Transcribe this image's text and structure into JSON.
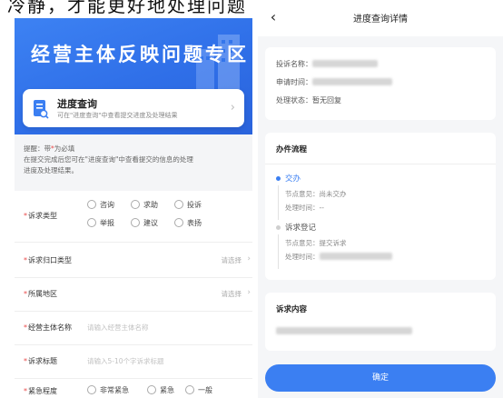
{
  "top_caption": "冷静，才能更好地处理问题",
  "left": {
    "banner_title": "经营主体反映问题专区",
    "query_card": {
      "title": "进度查询",
      "desc": "可在\"进度查询\"中查看提交进度及处理结果"
    },
    "notice": {
      "line1_prefix": "提醒：带",
      "required_mark": "*",
      "line1_suffix": "为必填",
      "line2": "在提交完成后您可在\"进度查询\"中查看提交的信息的处理",
      "line3": "进度及处理结果。"
    },
    "form": {
      "appeal_type": {
        "label": "诉求类型",
        "options": [
          "咨询",
          "求助",
          "投诉",
          "举报",
          "建议",
          "表扬"
        ]
      },
      "category": {
        "label": "诉求归口类型",
        "value": "请选择"
      },
      "region": {
        "label": "所属地区",
        "value": "请选择"
      },
      "entity_name": {
        "label": "经营主体名称",
        "placeholder": "请输入经营主体名称"
      },
      "appeal_title": {
        "label": "诉求标题",
        "placeholder": "请输入5-10个字诉求标题"
      },
      "urgency": {
        "label": "紧急程度",
        "options": [
          "非常紧急",
          "紧急",
          "一般"
        ]
      }
    }
  },
  "right": {
    "nav_title": "进度查询详情",
    "back_icon": "chevron-left-icon",
    "info": {
      "complaint_name_label": "投诉名称：",
      "apply_time_label": "申请时间：",
      "status_label": "处理状态：",
      "status_value": "暂无回复"
    },
    "process": {
      "title": "办件流程",
      "steps": [
        {
          "name": "交办",
          "opinion_label": "节点意见：",
          "opinion": "尚未交办",
          "time_label": "处理时间：",
          "time": "--",
          "color": "#3b7ff2"
        },
        {
          "name": "诉求登记",
          "opinion_label": "节点意见：",
          "opinion": "提交诉求",
          "time_label": "处理时间：",
          "time": "",
          "color": "#cfcfcf"
        }
      ]
    },
    "content": {
      "title": "诉求内容"
    },
    "confirm_label": "确定"
  },
  "colors": {
    "primary": "#3b7ff2",
    "required": "#e94b4b",
    "page_bg": "#f5f6f8"
  }
}
